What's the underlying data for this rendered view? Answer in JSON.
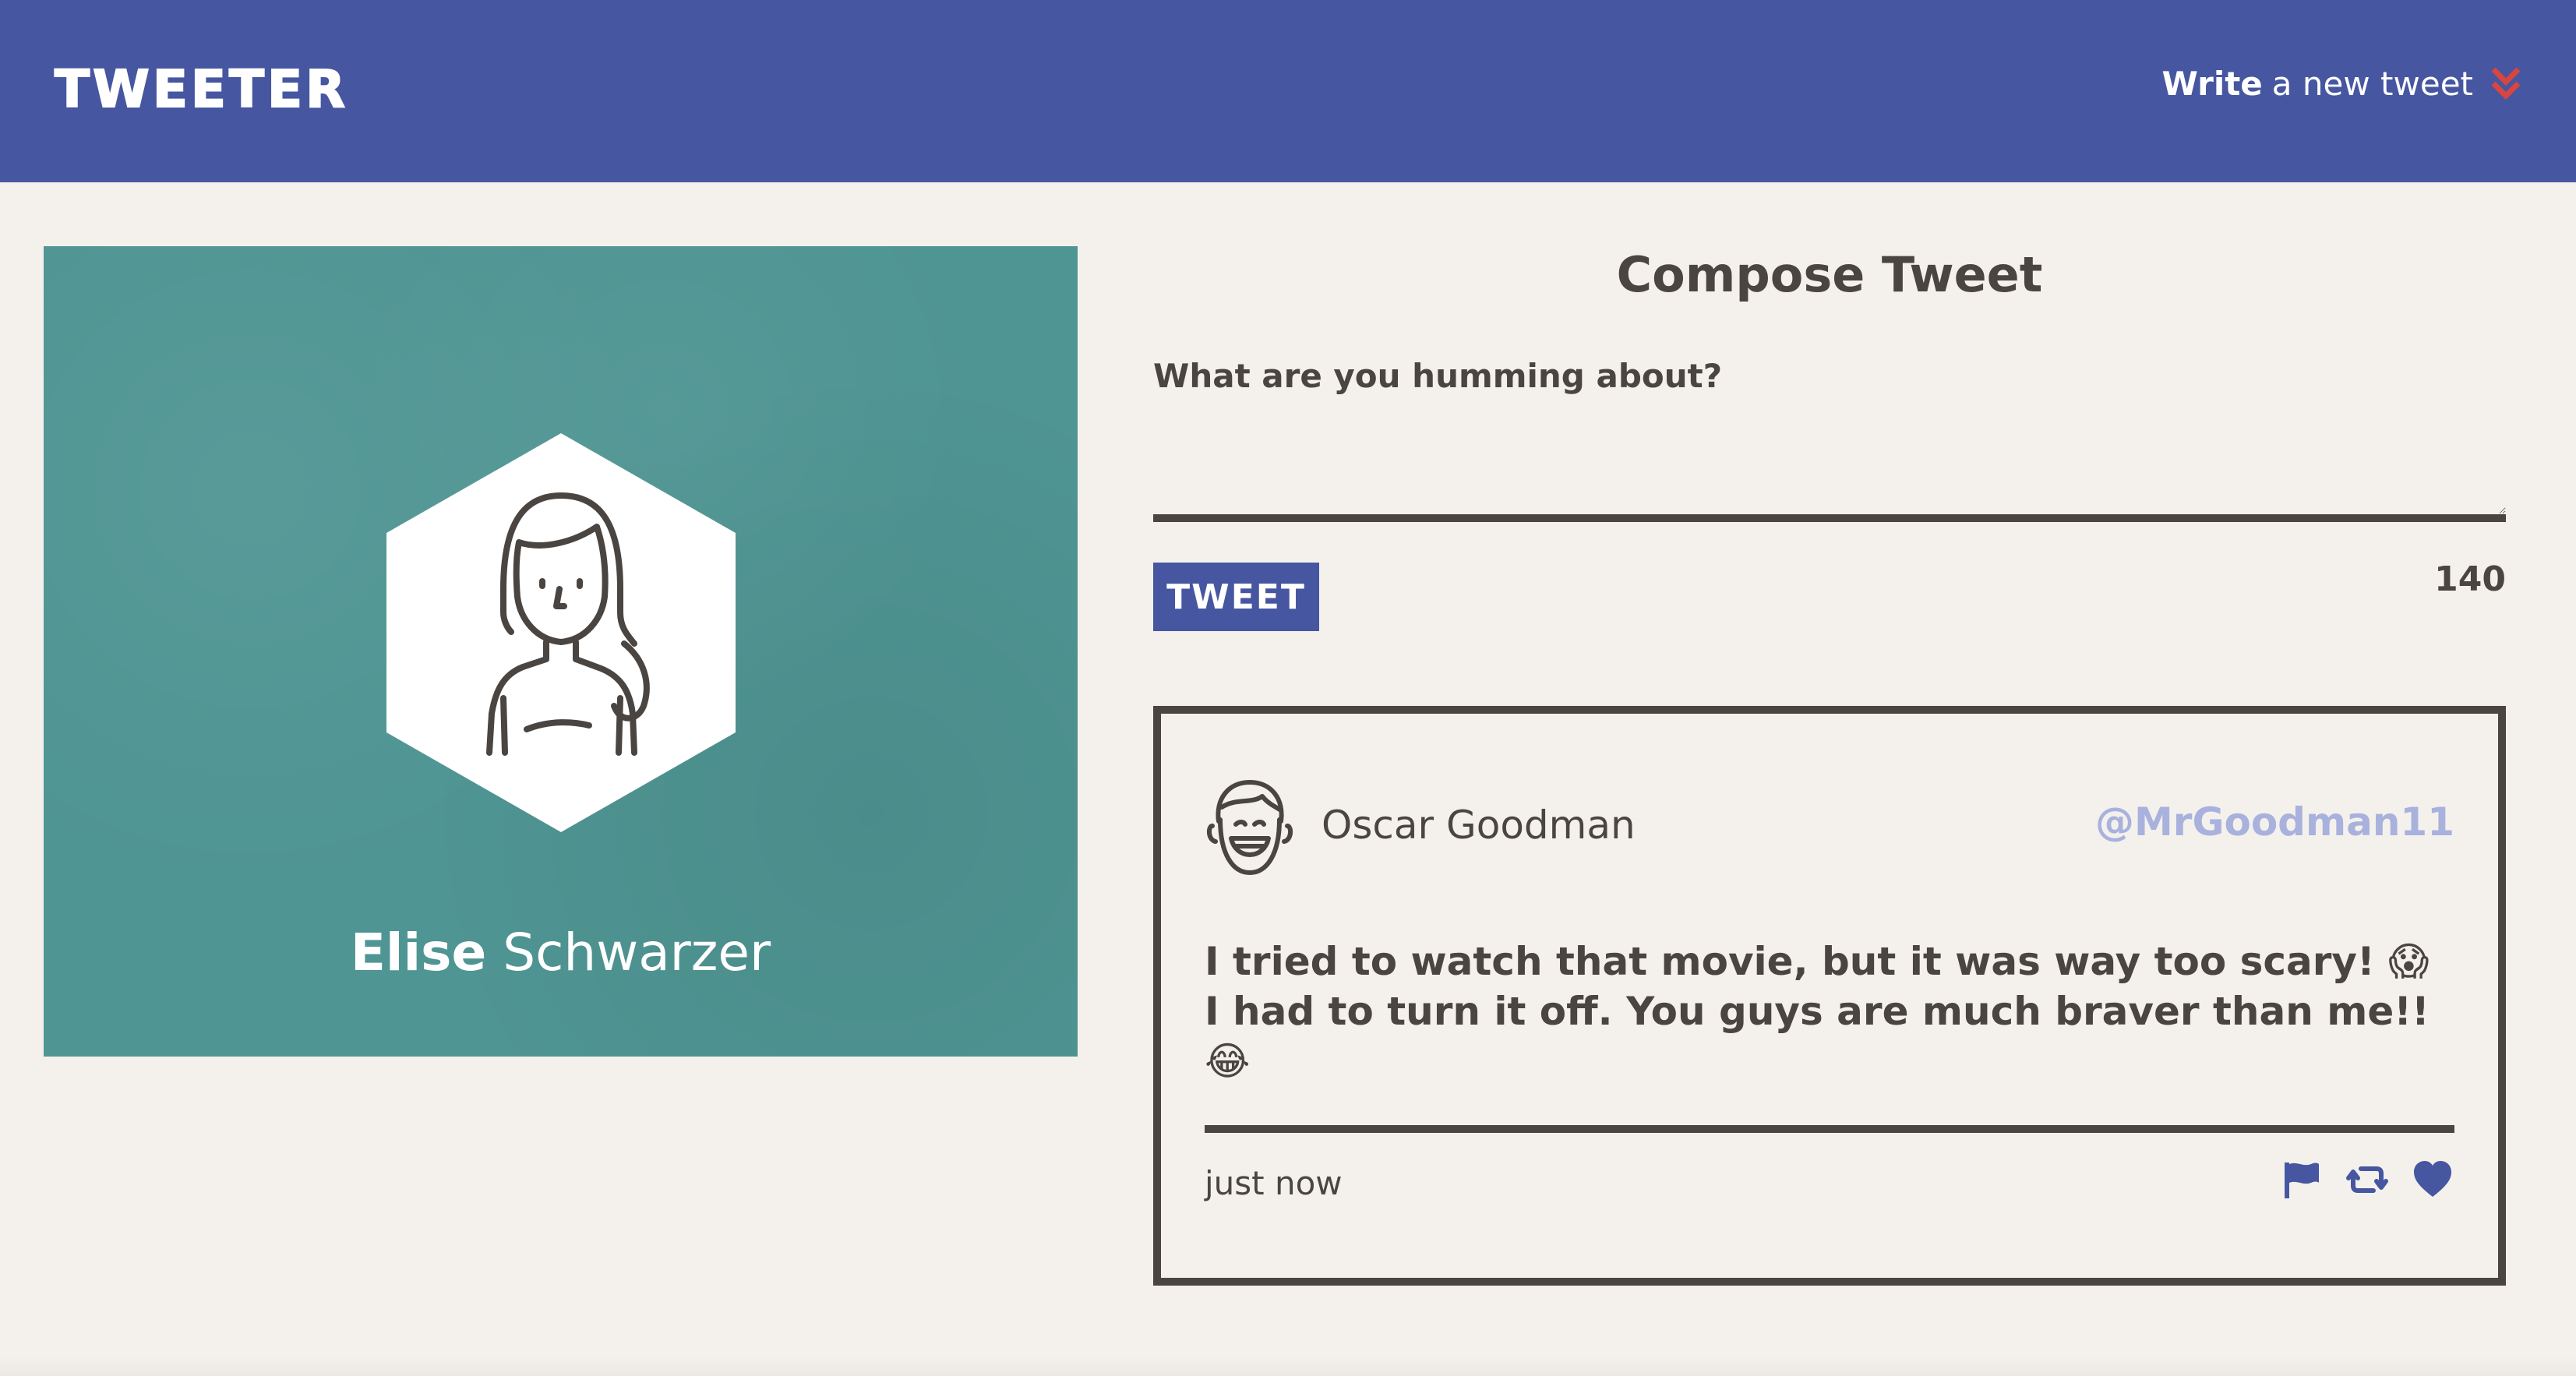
{
  "nav": {
    "logo": "Tweeter",
    "compose_strong": "Write",
    "compose_rest": "a new tweet"
  },
  "profile": {
    "first_name": "Elise",
    "last_name": "Schwarzer",
    "bg_color": "#4f9593"
  },
  "compose": {
    "title": "Compose Tweet",
    "label": "What are you humming about?",
    "textarea_value": "",
    "button_label": "Tweet",
    "counter": "140"
  },
  "tweet": {
    "author_name": "Oscar Goodman",
    "handle": "@MrGoodman11",
    "body": "I tried to watch that movie, but it was way too scary! 😱 I had to turn it off. You guys are much braver than me!! 😂",
    "timestamp": "just now",
    "actions": [
      "flag-icon",
      "retweet-icon",
      "heart-icon"
    ]
  },
  "colors": {
    "nav": "#4656a0",
    "accent": "#4656a0",
    "handle": "#a9b1dd",
    "chevron": "#d9453f",
    "text": "#4a4541",
    "page_bg": "#f4f1ec"
  }
}
